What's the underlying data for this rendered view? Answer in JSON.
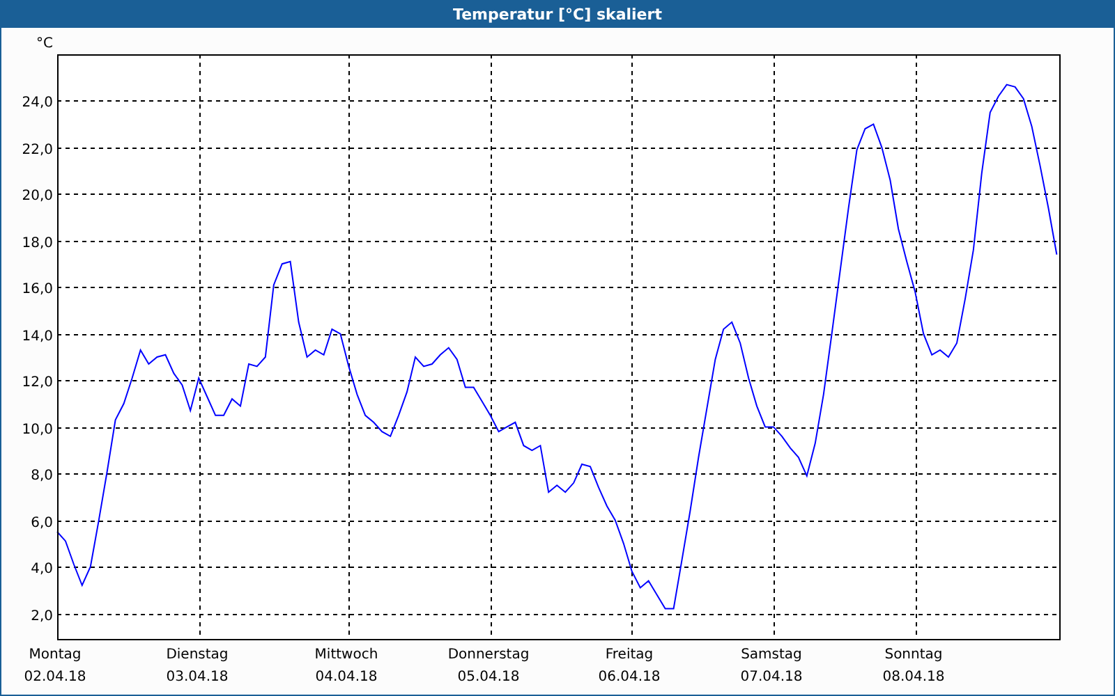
{
  "window": {
    "title": "Temperatur [°C] skaliert"
  },
  "chart": {
    "date_labels": [
      "02.04.18",
      "03.04.18",
      "04.04.18",
      "05.04.18",
      "06.04.18",
      "07.04.18",
      "08.04.18"
    ],
    "chart_data": {
      "type": "line",
      "grid": true,
      "ylabel": "°C",
      "ylim": [
        0.9,
        26
      ],
      "categories": [
        "Montag",
        null,
        null,
        null,
        null,
        null,
        null,
        null,
        null,
        null,
        null,
        null,
        null,
        null,
        null,
        null,
        null,
        "Dienstag",
        null,
        null,
        null,
        null,
        null,
        null,
        null,
        null,
        null,
        null,
        null,
        null,
        null,
        null,
        null,
        null,
        null,
        "Mittwoch",
        null,
        null,
        null,
        null,
        null,
        null,
        null,
        null,
        null,
        null,
        null,
        null,
        null,
        null,
        null,
        null,
        "Donnerstag",
        null,
        null,
        null,
        null,
        null,
        null,
        null,
        null,
        null,
        null,
        null,
        null,
        null,
        null,
        null,
        null,
        "Freitag",
        null,
        null,
        null,
        null,
        null,
        null,
        null,
        null,
        null,
        null,
        null,
        null,
        null,
        null,
        null,
        null,
        "Samstag",
        null,
        null,
        null,
        null,
        null,
        null,
        null,
        null,
        null,
        null,
        null,
        null,
        null,
        null,
        null,
        null,
        "Sonntag",
        null,
        null,
        null,
        null,
        null,
        null,
        null,
        null,
        null,
        null,
        null,
        null,
        null,
        null,
        null,
        null,
        null
      ],
      "yticks": [
        {
          "value": 2,
          "label": "2,0"
        },
        {
          "value": 4,
          "label": "4,0"
        },
        {
          "value": 6,
          "label": "6,0"
        },
        {
          "value": 8,
          "label": "8,0"
        },
        {
          "value": 10,
          "label": "10,0"
        },
        {
          "value": 12,
          "label": "12,0"
        },
        {
          "value": 14,
          "label": "14,0"
        },
        {
          "value": 16,
          "label": "16,0"
        },
        {
          "value": 18,
          "label": "18,0"
        },
        {
          "value": 20,
          "label": "20,0"
        },
        {
          "value": 22,
          "label": "22,0"
        },
        {
          "value": 24,
          "label": "24,0"
        }
      ],
      "series": [
        {
          "color": "#0000ff",
          "values": [
            5.5,
            5.1,
            4.1,
            3.2,
            4.0,
            6.0,
            8.1,
            10.3,
            11.0,
            12.1,
            13.3,
            12.7,
            13.0,
            13.1,
            12.3,
            11.8,
            10.7,
            12.1,
            11.3,
            10.5,
            10.5,
            11.2,
            10.9,
            12.7,
            12.6,
            13.0,
            16.1,
            17.0,
            17.1,
            14.5,
            13.0,
            13.3,
            13.1,
            14.2,
            14.0,
            12.6,
            11.4,
            10.5,
            10.2,
            9.8,
            9.6,
            10.5,
            11.5,
            13.0,
            12.6,
            12.7,
            13.1,
            13.4,
            12.9,
            11.7,
            11.7,
            11.1,
            10.5,
            9.8,
            10.0,
            10.2,
            9.2,
            9.0,
            9.2,
            7.2,
            7.5,
            7.2,
            7.6,
            8.4,
            8.3,
            7.4,
            6.6,
            6.0,
            5.0,
            3.8,
            3.1,
            3.4,
            2.8,
            2.2,
            2.2,
            4.3,
            6.4,
            8.7,
            10.8,
            12.9,
            14.2,
            14.5,
            13.6,
            12.1,
            10.9,
            10.0,
            10.0,
            9.6,
            9.1,
            8.7,
            7.9,
            9.3,
            11.4,
            14.0,
            16.7,
            19.4,
            21.9,
            22.8,
            23.0,
            22.0,
            20.6,
            18.5,
            17.1,
            15.8,
            14.0,
            13.1,
            13.3,
            13.0,
            13.6,
            15.5,
            17.6,
            20.9,
            23.5,
            24.2,
            24.7,
            24.6,
            24.1,
            22.9,
            21.2,
            19.4,
            17.4
          ]
        }
      ]
    }
  }
}
